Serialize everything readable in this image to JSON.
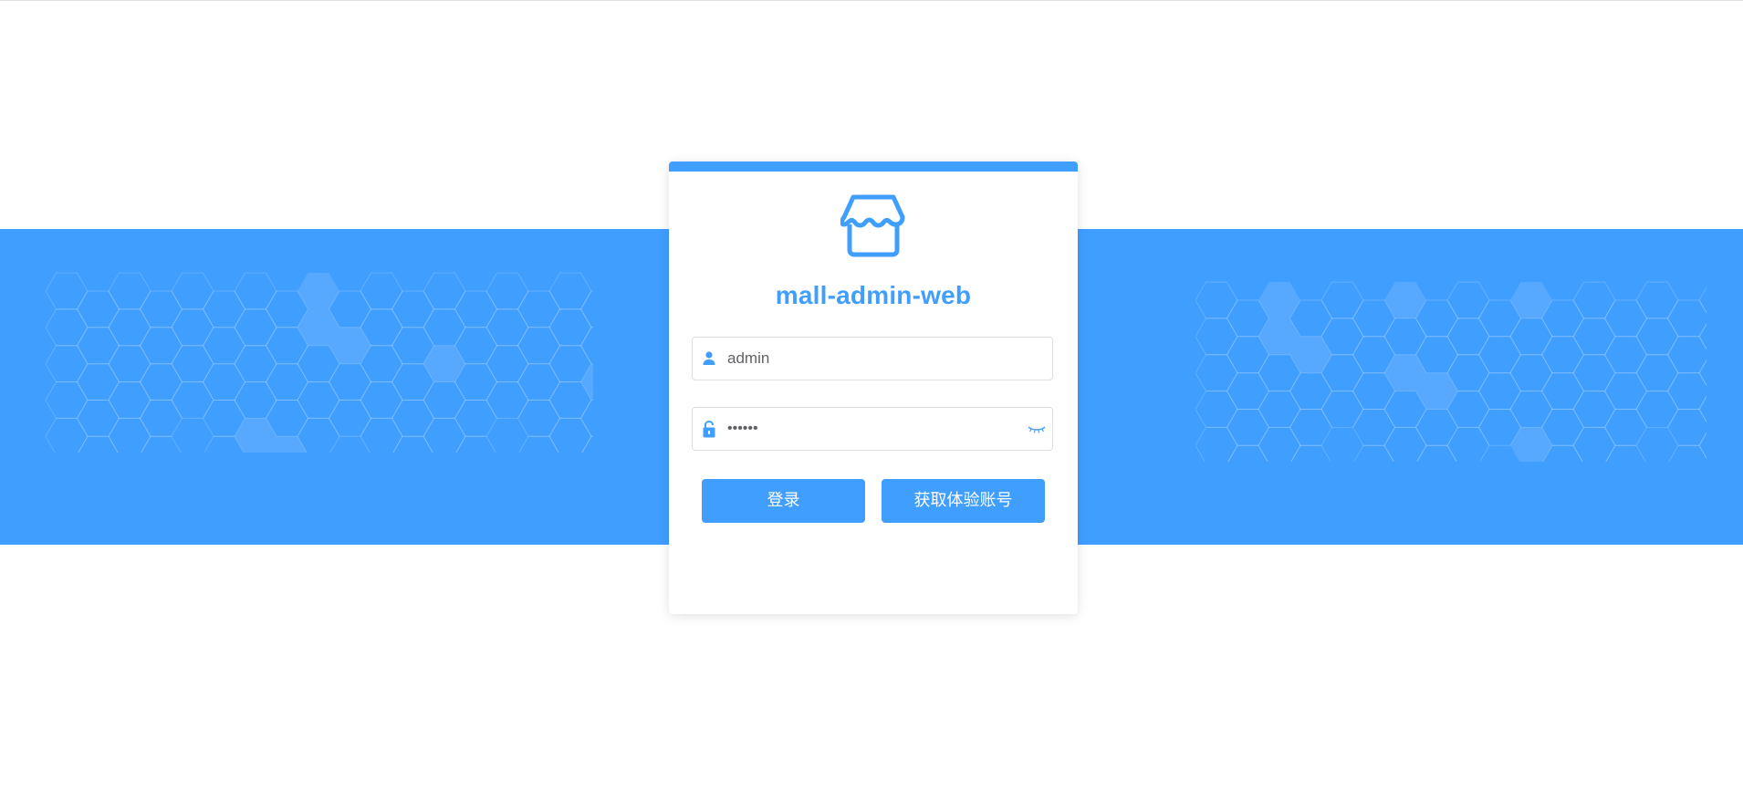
{
  "app": {
    "title": "mall-admin-web"
  },
  "login_form": {
    "username_value": "admin",
    "password_masked": "••••••",
    "login_button_label": "登录",
    "trial_button_label": "获取体验账号"
  },
  "icons": {
    "logo": "shop-icon",
    "username_prefix": "user-icon",
    "password_prefix": "lock-icon",
    "password_suffix": "eye-closed-icon"
  },
  "colors": {
    "accent": "#409eff",
    "text": "#606266",
    "border": "#dcdfe6",
    "background": "#ffffff"
  }
}
